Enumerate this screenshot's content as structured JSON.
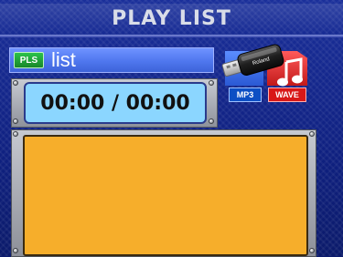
{
  "header": {
    "title": "PLAY LIST"
  },
  "playlist": {
    "badge": "PLS",
    "label": "list"
  },
  "player": {
    "time": "00:00 / 00:00"
  },
  "media": {
    "usb_brand": "Roland",
    "mp3_label": "MP3",
    "wave_label": "WAVE"
  },
  "colors": {
    "background": "#0f2080",
    "display": "#8bd6ff",
    "list_area": "#f6ae2b",
    "pls": "#18862a"
  }
}
